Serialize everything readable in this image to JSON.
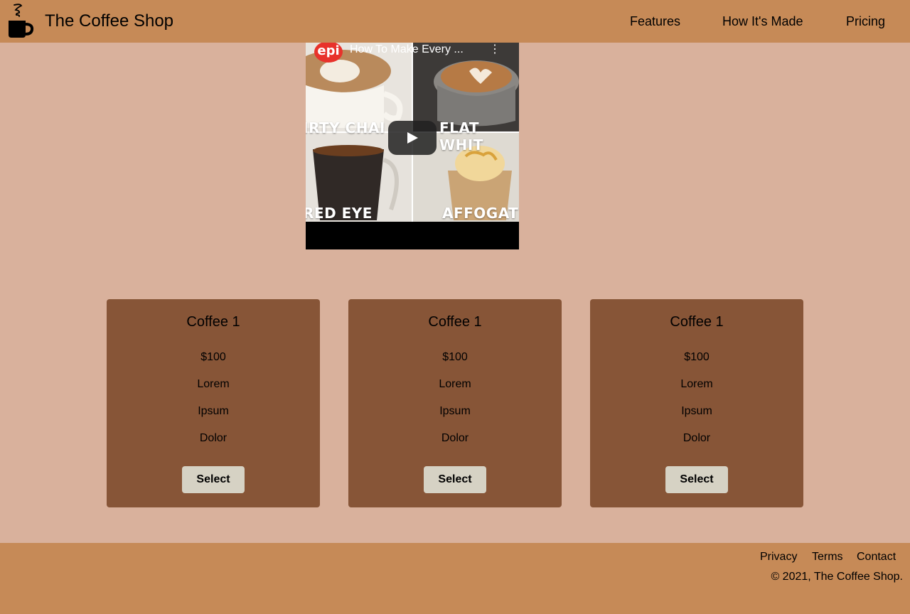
{
  "header": {
    "brand": "The Coffee Shop",
    "nav": [
      "Features",
      "How It's Made",
      "Pricing"
    ]
  },
  "video": {
    "channel": "epi",
    "title": "How To Make Every ...",
    "captions": [
      "IRTY CHAI",
      "FLAT WHIT",
      "RED EYE",
      "AFFOGAT"
    ]
  },
  "cards": [
    {
      "title": "Coffee 1",
      "price": "$100",
      "features": [
        "Lorem",
        "Ipsum",
        "Dolor"
      ],
      "button": "Select"
    },
    {
      "title": "Coffee 1",
      "price": "$100",
      "features": [
        "Lorem",
        "Ipsum",
        "Dolor"
      ],
      "button": "Select"
    },
    {
      "title": "Coffee 1",
      "price": "$100",
      "features": [
        "Lorem",
        "Ipsum",
        "Dolor"
      ],
      "button": "Select"
    }
  ],
  "footer": {
    "links": [
      "Privacy",
      "Terms",
      "Contact"
    ],
    "copyright": "© 2021, The Coffee Shop."
  },
  "colors": {
    "header_bg": "#c68a57",
    "page_bg": "#d9b19c",
    "card_bg": "#875537",
    "button_bg": "#d6d2c4"
  }
}
